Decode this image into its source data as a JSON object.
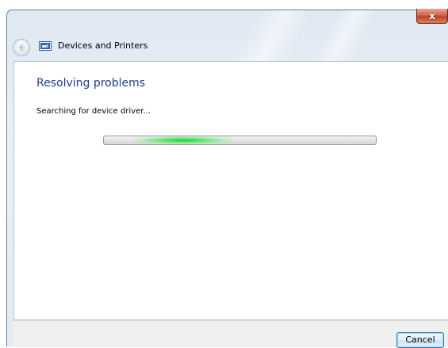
{
  "window": {
    "title": "Devices and Printers",
    "close_symbol": "x",
    "icons": {
      "back": "back-arrow-icon",
      "app": "devices-and-printers-icon",
      "close": "close-icon"
    }
  },
  "main": {
    "heading": "Resolving problems",
    "status": "Searching for device driver...",
    "progress": {
      "indeterminate": true,
      "accent_color": "#22cc33"
    }
  },
  "footer": {
    "cancel_label": "Cancel"
  }
}
